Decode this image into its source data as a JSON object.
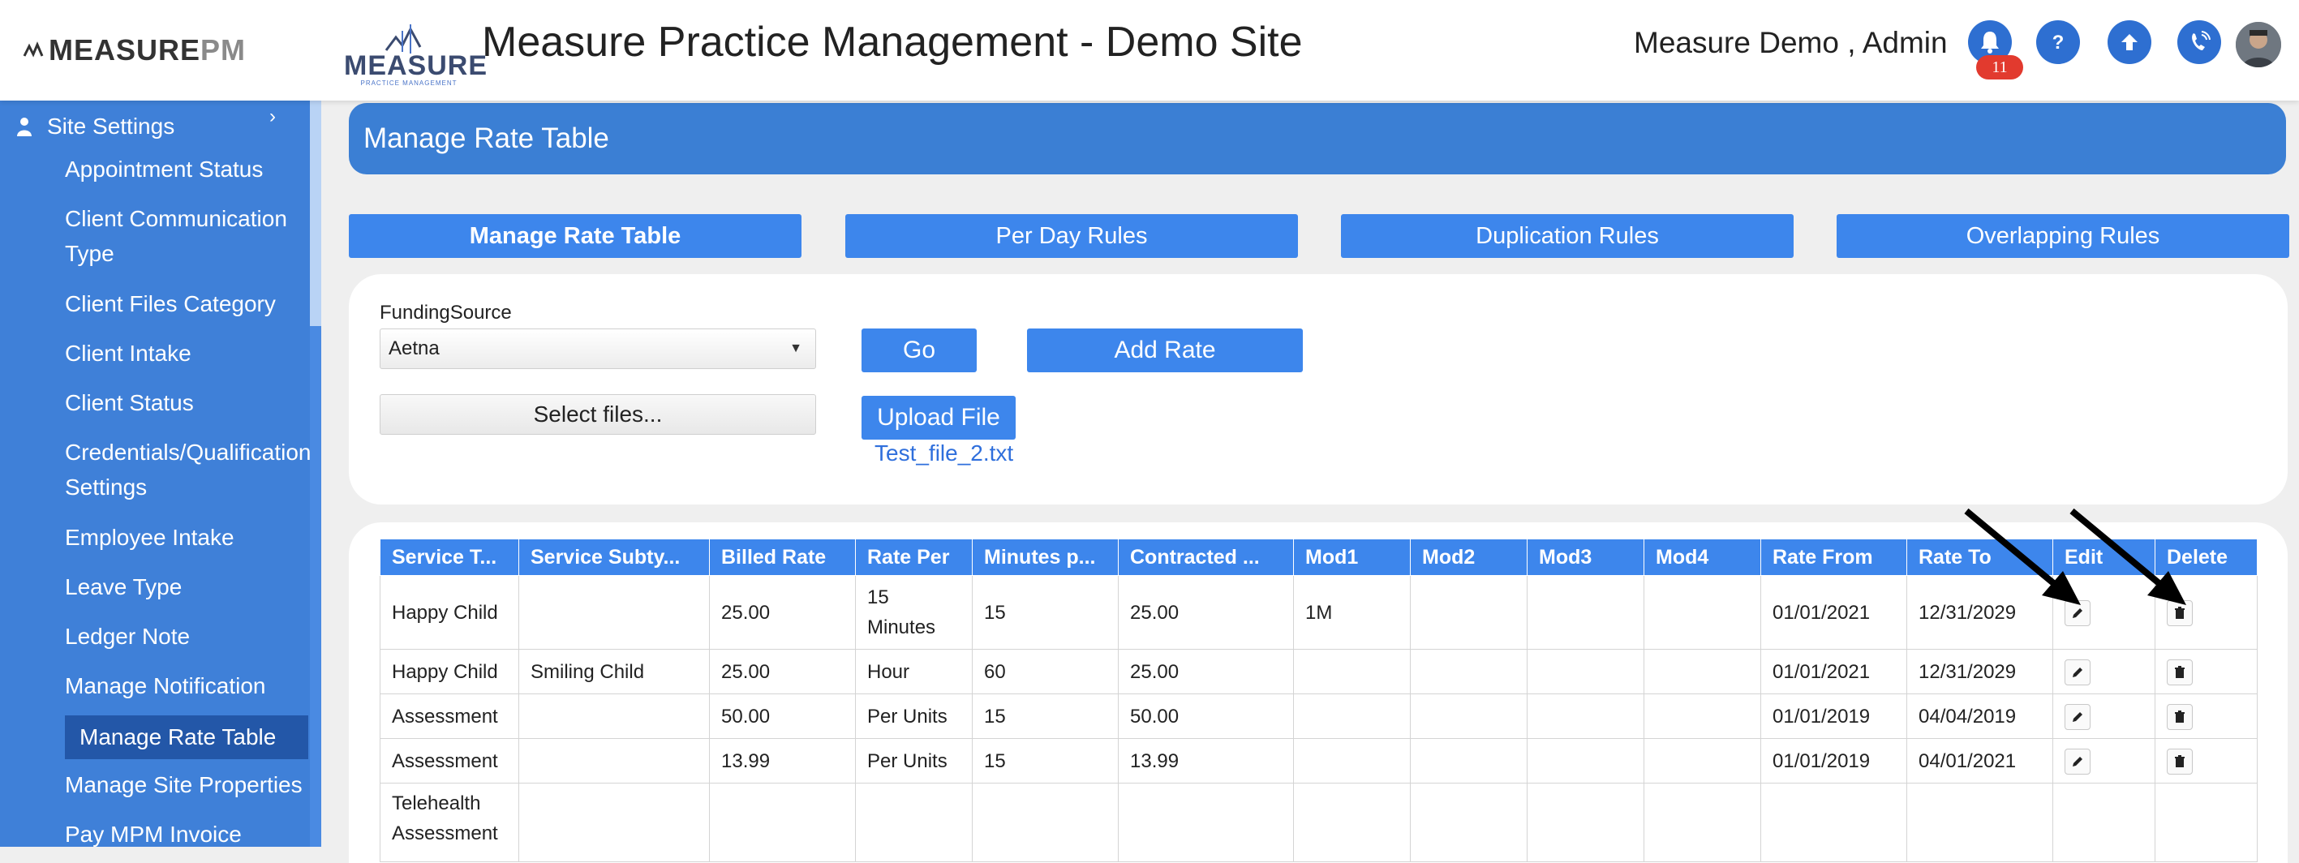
{
  "header": {
    "brand_left_main": "MEASURE",
    "brand_left_pm": "PM",
    "logo_word": "MEASURE",
    "logo_sub": "PRACTICE MANAGEMENT",
    "app_title": "Measure Practice Management - Demo Site",
    "user_name": "Measure Demo , Admin",
    "notification_count": "11",
    "icons": [
      "bell-icon",
      "help-icon",
      "upload-icon",
      "phone-icon",
      "avatar"
    ]
  },
  "sidebar": {
    "section": "Site Settings",
    "chevron": "›",
    "items": [
      {
        "label": "Appointment Status"
      },
      {
        "label": "Client Communication Type"
      },
      {
        "label": "Client Files Category"
      },
      {
        "label": "Client Intake"
      },
      {
        "label": "Client Status"
      },
      {
        "label": "Credentials/Qualification Settings"
      },
      {
        "label": "Employee Intake"
      },
      {
        "label": "Leave Type"
      },
      {
        "label": "Ledger Note"
      },
      {
        "label": "Manage Notification"
      },
      {
        "label": "Manage Rate Table",
        "active": true
      },
      {
        "label": "Manage Site Properties"
      },
      {
        "label": "Pay MPM Invoice"
      }
    ]
  },
  "page": {
    "title": "Manage Rate Table",
    "tabs": [
      {
        "label": "Manage Rate Table",
        "active": true
      },
      {
        "label": "Per Day Rules"
      },
      {
        "label": "Duplication Rules"
      },
      {
        "label": "Overlapping Rules"
      }
    ]
  },
  "form": {
    "funding_label": "FundingSource",
    "funding_value": "Aetna",
    "caret": "▼",
    "go_label": "Go",
    "add_rate_label": "Add Rate",
    "select_files_label": "Select files...",
    "upload_label": "Upload File",
    "uploaded_file": "Test_file_2.txt"
  },
  "table": {
    "headers": [
      "Service T...",
      "Service Subty...",
      "Billed Rate",
      "Rate Per",
      "Minutes p...",
      "Contracted ...",
      "Mod1",
      "Mod2",
      "Mod3",
      "Mod4",
      "Rate From",
      "Rate To",
      "Edit",
      "Delete"
    ],
    "rows": [
      [
        "Happy Child",
        "",
        "25.00",
        "15 Minutes",
        "15",
        "25.00",
        "1M",
        "",
        "",
        "",
        "01/01/2021",
        "12/31/2029"
      ],
      [
        "Happy Child",
        "Smiling Child",
        "25.00",
        "Hour",
        "60",
        "25.00",
        "",
        "",
        "",
        "",
        "01/01/2021",
        "12/31/2029"
      ],
      [
        "Assessment",
        "",
        "50.00",
        "Per Units",
        "15",
        "50.00",
        "",
        "",
        "",
        "",
        "01/01/2019",
        "04/04/2019"
      ],
      [
        "Assessment",
        "",
        "13.99",
        "Per Units",
        "15",
        "13.99",
        "",
        "",
        "",
        "",
        "01/01/2019",
        "04/01/2021"
      ],
      [
        "Telehealth Assessment",
        "",
        "",
        "",
        "",
        "",
        "",
        "",
        "",
        "",
        "",
        ""
      ]
    ]
  },
  "colors": {
    "primary": "#3d86ec",
    "sidebar": "#3f80d8",
    "sidebar_active": "#2357a8",
    "header_bar": "#3b7fd4",
    "badge": "#e23a2e",
    "link": "#2f6fdc"
  }
}
